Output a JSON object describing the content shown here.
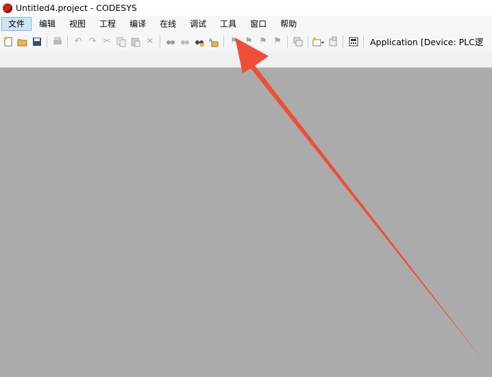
{
  "window": {
    "title": "Untitled4.project - CODESYS"
  },
  "menu": {
    "items": [
      "文件",
      "编辑",
      "视图",
      "工程",
      "编译",
      "在线",
      "调试",
      "工具",
      "窗口",
      "帮助"
    ],
    "active_index": 0
  },
  "toolbar": {
    "application_label": "Application [Device: PLC逻"
  },
  "annotation": {
    "color": "#f04e37",
    "points_to": "工具"
  }
}
